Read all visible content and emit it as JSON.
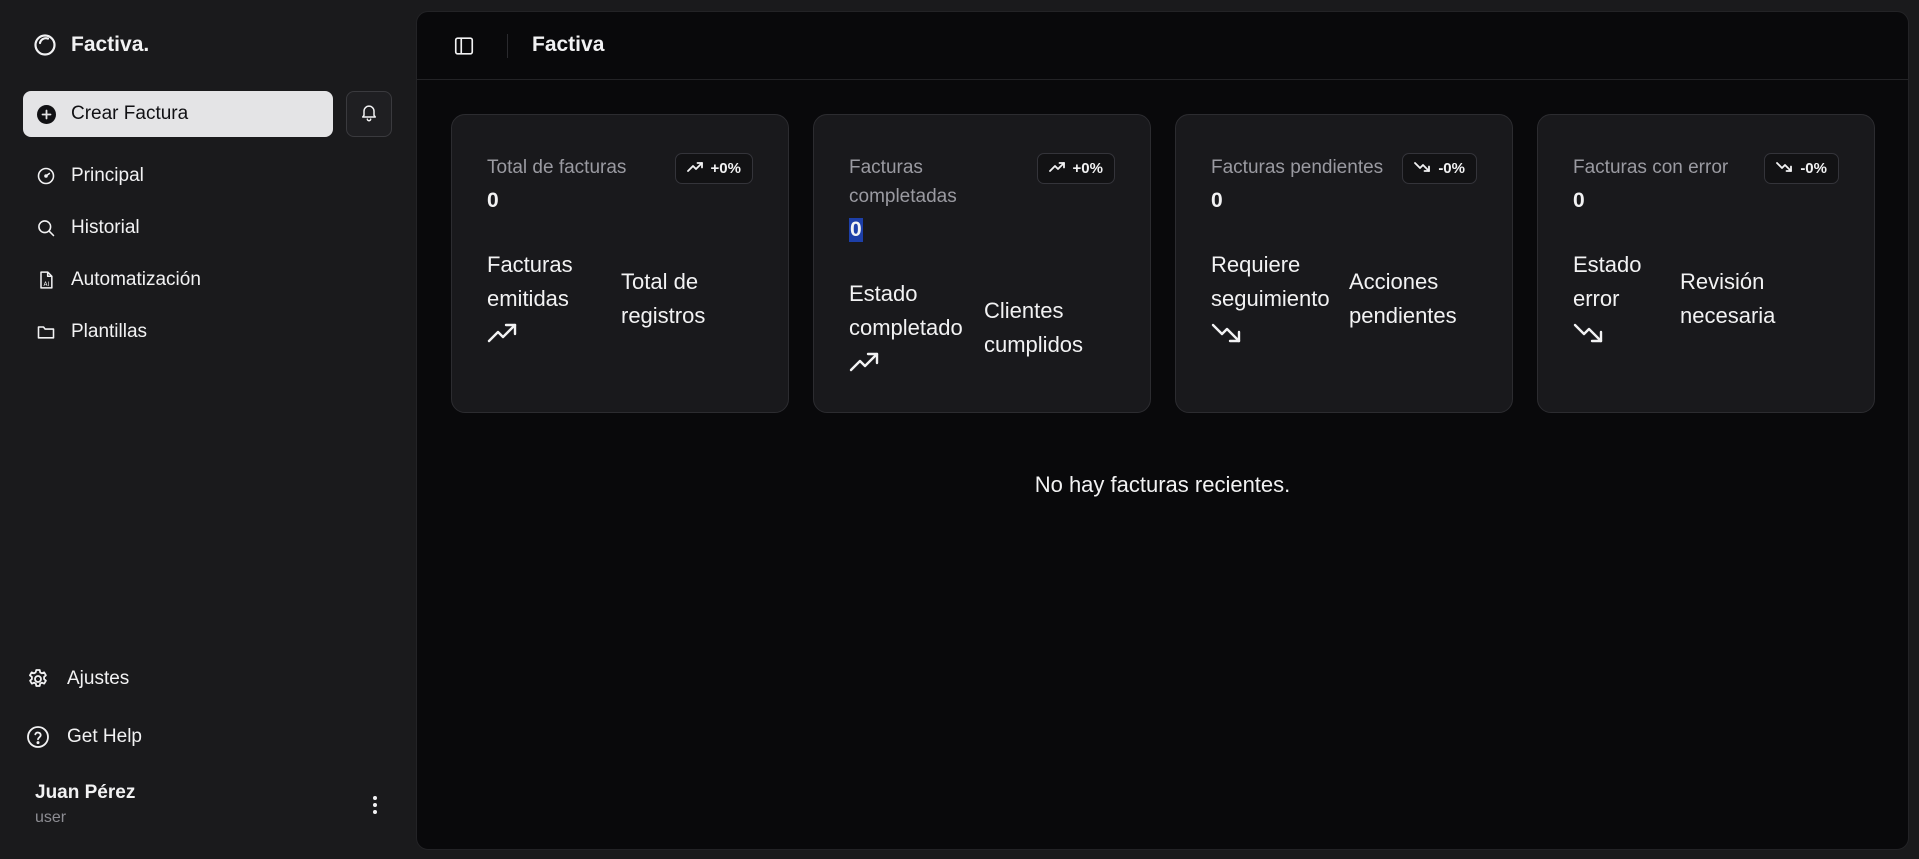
{
  "brand": {
    "name": "Factiva.",
    "icon": "circle-logo-icon"
  },
  "sidebar": {
    "create_label": "Crear Factura",
    "nav": [
      {
        "label": "Principal",
        "icon": "gauge-icon"
      },
      {
        "label": "Historial",
        "icon": "search-icon"
      },
      {
        "label": "Automatización",
        "icon": "document-ai-icon"
      },
      {
        "label": "Plantillas",
        "icon": "folder-icon"
      }
    ],
    "bottom": [
      {
        "label": "Ajustes",
        "icon": "gear-icon"
      },
      {
        "label": "Get Help",
        "icon": "help-circle-icon"
      }
    ],
    "user": {
      "name": "Juan Pérez",
      "role": "user"
    }
  },
  "header": {
    "title": "Factiva"
  },
  "cards": [
    {
      "label": "Total de facturas",
      "value": "0",
      "badge": "+0%",
      "trend": "up",
      "foot_primary": "Facturas emitidas",
      "foot_secondary": "Total de registros"
    },
    {
      "label": "Facturas completadas",
      "value": "0",
      "badge": "+0%",
      "trend": "up",
      "foot_primary": "Estado completado",
      "foot_secondary": "Clientes cumplidos"
    },
    {
      "label": "Facturas pendientes",
      "value": "0",
      "badge": "-0%",
      "trend": "down",
      "foot_primary": "Requiere seguimiento",
      "foot_secondary": "Acciones pendientes"
    },
    {
      "label": "Facturas con error",
      "value": "0",
      "badge": "-0%",
      "trend": "down",
      "foot_primary": "Estado error",
      "foot_secondary": "Revisión necesaria"
    }
  ],
  "empty_message": "No hay facturas recientes.",
  "colors": {
    "background": "#1a1a1c",
    "main": "#09090b",
    "card": "#19191c",
    "button": "#e4e4e6",
    "selection": "#1d3fa8"
  }
}
